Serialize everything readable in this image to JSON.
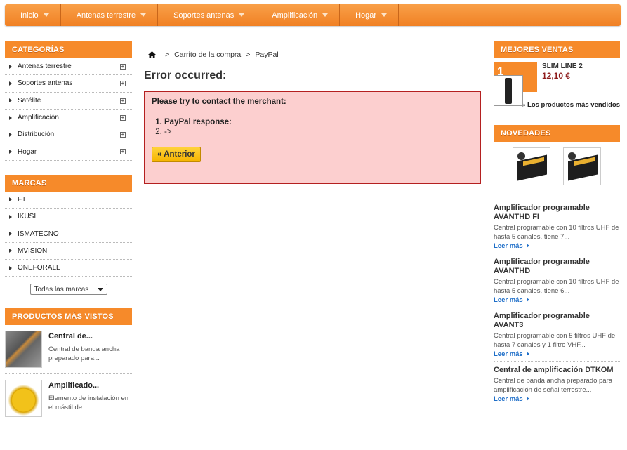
{
  "nav": {
    "items": [
      {
        "label": "Inicio"
      },
      {
        "label": "Antenas terrestre"
      },
      {
        "label": "Soportes antenas"
      },
      {
        "label": "Amplificación"
      },
      {
        "label": "Hogar"
      }
    ]
  },
  "left": {
    "categories": {
      "title": "CATEGORÍAS",
      "items": [
        "Antenas terrestre",
        "Soportes antenas",
        "Satélite",
        "Amplificación",
        "Distribución",
        "Hogar"
      ]
    },
    "brands": {
      "title": "MARCAS",
      "items": [
        "FTE",
        "IKUSI",
        "ISMATECNO",
        "MVISION",
        "ONEFORALL"
      ],
      "select_value": "Todas las marcas"
    },
    "viewed": {
      "title": "PRODUCTOS MÁS VISTOS",
      "items": [
        {
          "name": "Central de...",
          "desc": "Central de banda ancha preparado para..."
        },
        {
          "name": "Amplificado...",
          "desc": "Elemento de instalación en el mástil de..."
        }
      ]
    }
  },
  "main": {
    "breadcrumb": {
      "sep": ">",
      "items": [
        "Carrito de la compra",
        "PayPal"
      ]
    },
    "title": "Error occurred:",
    "error": {
      "message": "Please try to contact the merchant:",
      "list": [
        "PayPal response:",
        "->"
      ],
      "button": "« Anterior"
    }
  },
  "right": {
    "best": {
      "title": "MEJORES VENTAS",
      "rank": "1",
      "name": "SLIM LINE 2",
      "price": "12,10 €",
      "link": "» Los productos más vendidos"
    },
    "news": {
      "title": "NOVEDADES",
      "items": [
        {
          "title": "Amplificador programable AVANTHD FI",
          "desc": "Central programable con 10 filtros UHF de hasta 5 canales, tiene 7...",
          "more": "Leer más"
        },
        {
          "title": "Amplificador programable AVANTHD",
          "desc": "Central programable con 10 filtros UHF de hasta 5 canales, tiene 6...",
          "more": "Leer más"
        },
        {
          "title": "Amplificador programable AVANT3",
          "desc": "Central programable con 5 filtros UHF de hasta 7 canales  y 1 filtro VHF...",
          "more": "Leer más"
        },
        {
          "title": "Central de amplificación DTKOM",
          "desc": "Central de banda ancha preparado para amplificación de señal terrestre...",
          "more": "Leer más"
        }
      ]
    }
  },
  "colors": {
    "accent": "#f68a2a",
    "error_bg": "#fccfcf",
    "error_border": "#b42020",
    "price": "#8e1b1b",
    "link": "#1e6ec8"
  }
}
